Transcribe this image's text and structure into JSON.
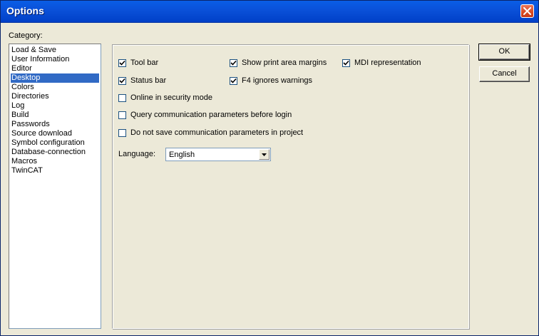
{
  "window": {
    "title": "Options"
  },
  "category": {
    "label": "Category:",
    "items": [
      {
        "label": "Load & Save"
      },
      {
        "label": "User Information"
      },
      {
        "label": "Editor"
      },
      {
        "label": "Desktop",
        "selected": true
      },
      {
        "label": "Colors"
      },
      {
        "label": "Directories"
      },
      {
        "label": "Log"
      },
      {
        "label": "Build"
      },
      {
        "label": "Passwords"
      },
      {
        "label": "Source download"
      },
      {
        "label": "Symbol configuration"
      },
      {
        "label": "Database-connection"
      },
      {
        "label": "Macros"
      },
      {
        "label": "TwinCAT"
      }
    ]
  },
  "options": {
    "tool_bar": {
      "label": "Tool bar",
      "checked": true
    },
    "status_bar": {
      "label": "Status bar",
      "checked": true
    },
    "show_print_area_margins": {
      "label": "Show print area margins",
      "checked": true
    },
    "f4_ignores_warnings": {
      "label": "F4 ignores warnings",
      "checked": true
    },
    "mdi_representation": {
      "label": "MDI representation",
      "checked": true
    },
    "online_security_mode": {
      "label": "Online in security mode",
      "checked": false
    },
    "query_comm_params": {
      "label": "Query communication parameters before login",
      "checked": false
    },
    "no_save_comm_params": {
      "label": "Do not save communication parameters in project",
      "checked": false
    }
  },
  "language": {
    "label": "Language:",
    "value": "English"
  },
  "buttons": {
    "ok": "OK",
    "cancel": "Cancel"
  },
  "colors": {
    "titlebar": "#0a50d8",
    "selection": "#316ac5",
    "dialog_bg": "#ece9d8"
  }
}
